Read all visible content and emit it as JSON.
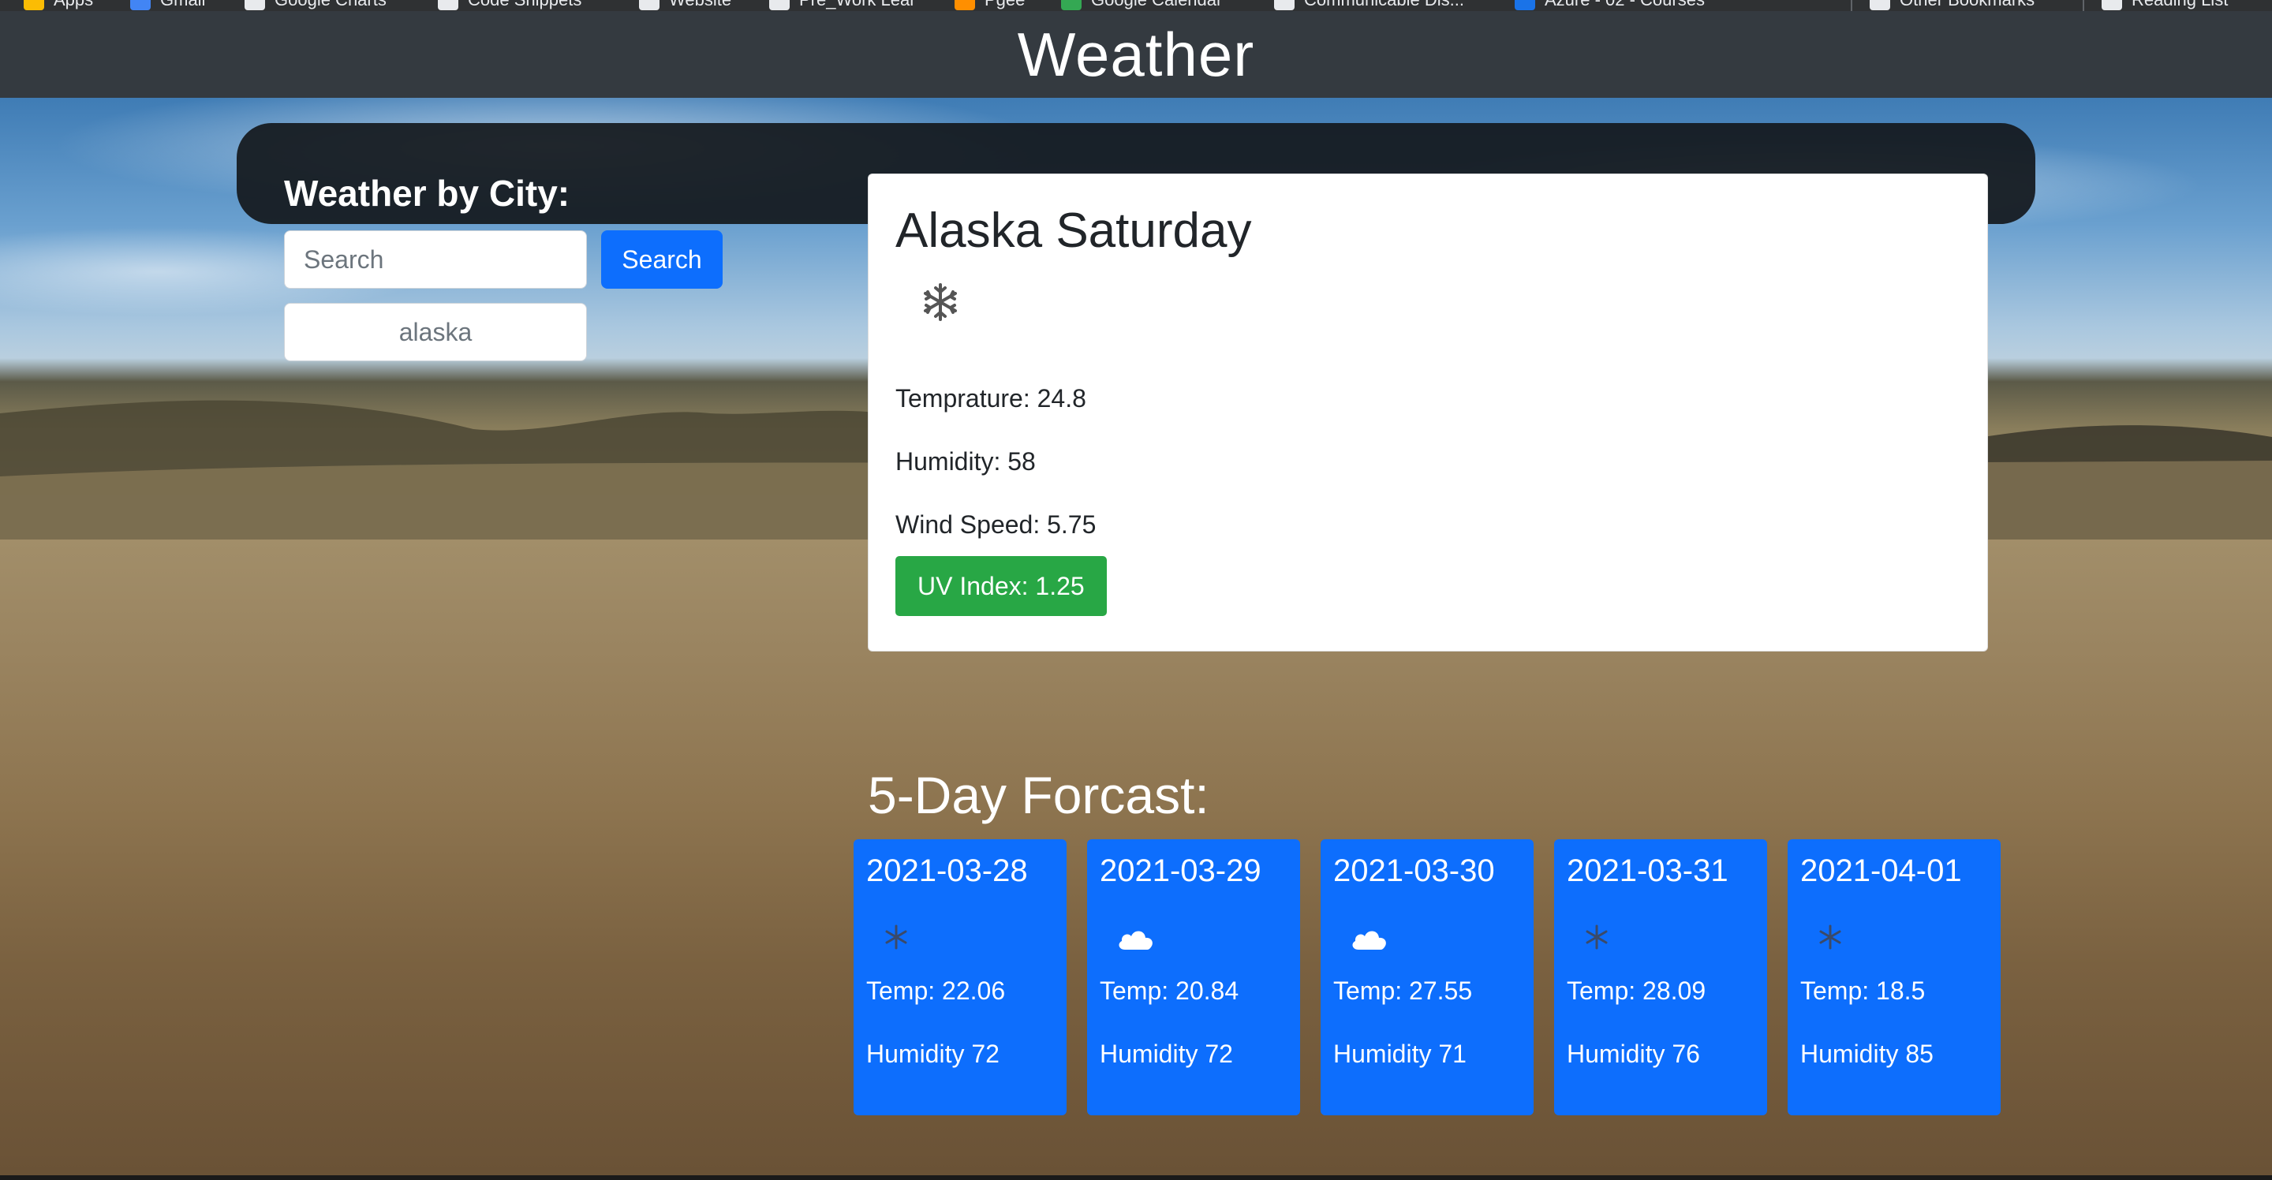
{
  "site": {
    "title": "Weather"
  },
  "browser_bookmarks": [
    "Apps",
    "Gmail",
    "Google Charts",
    "Code Snippets",
    "Website",
    "Pre_Work Lear",
    "Pgee",
    "Google Calendar",
    "Communicable Dis...",
    "Azure - 02 - Courses",
    "Other Bookmarks",
    "Reading List"
  ],
  "search": {
    "heading": "Weather by City:",
    "placeholder": "Search",
    "button_label": "Search",
    "history": [
      "alaska"
    ]
  },
  "current": {
    "title": "Alaska Saturday",
    "icon": "snowflake-icon",
    "temperature": "Temprature: 24.8",
    "humidity": "Humidity: 58",
    "wind_speed": "Wind Speed: 5.75",
    "uv_index": "UV Index: 1.25",
    "uv_color": "#28a745"
  },
  "forecast": {
    "heading": "5-Day Forcast:",
    "days": [
      {
        "date": "2021-03-28",
        "icon": "snowflake-icon",
        "temp": "Temp: 22.06",
        "humidity": "Humidity 72"
      },
      {
        "date": "2021-03-29",
        "icon": "cloud-icon",
        "temp": "Temp: 20.84",
        "humidity": "Humidity 72"
      },
      {
        "date": "2021-03-30",
        "icon": "cloud-icon",
        "temp": "Temp: 27.55",
        "humidity": "Humidity 71"
      },
      {
        "date": "2021-03-31",
        "icon": "snowflake-icon",
        "temp": "Temp: 28.09",
        "humidity": "Humidity 76"
      },
      {
        "date": "2021-04-01",
        "icon": "snowflake-icon",
        "temp": "Temp: 18.5",
        "humidity": "Humidity 85"
      }
    ]
  },
  "colors": {
    "header_bg": "#343a40",
    "primary": "#0d6efd",
    "success": "#28a745"
  }
}
